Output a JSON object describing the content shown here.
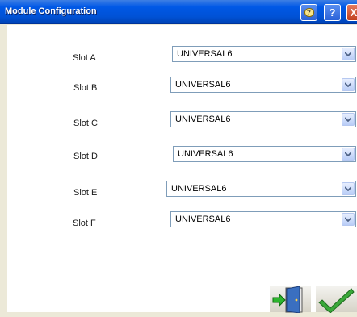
{
  "window": {
    "title": "Module Configuration",
    "help_bubble_glyph": "?",
    "help_glyph": "?",
    "close_glyph": "X"
  },
  "slots": [
    {
      "label": "Slot A",
      "value": "UNIVERSAL6"
    },
    {
      "label": "Slot B",
      "value": "UNIVERSAL6"
    },
    {
      "label": "Slot C",
      "value": "UNIVERSAL6"
    },
    {
      "label": "Slot D",
      "value": "UNIVERSAL6"
    },
    {
      "label": "Slot E",
      "value": "UNIVERSAL6"
    },
    {
      "label": "Slot F",
      "value": "UNIVERSAL6"
    }
  ],
  "icons": {
    "exit": "exit-door-icon",
    "ok": "checkmark-icon"
  },
  "colors": {
    "titlebar": "#0058e6",
    "background": "#ffffff",
    "dropdown_border": "#7f9db9",
    "checkmark": "#3aa83a",
    "door": "#3a6fc0",
    "exit_arrow": "#2db52d"
  }
}
